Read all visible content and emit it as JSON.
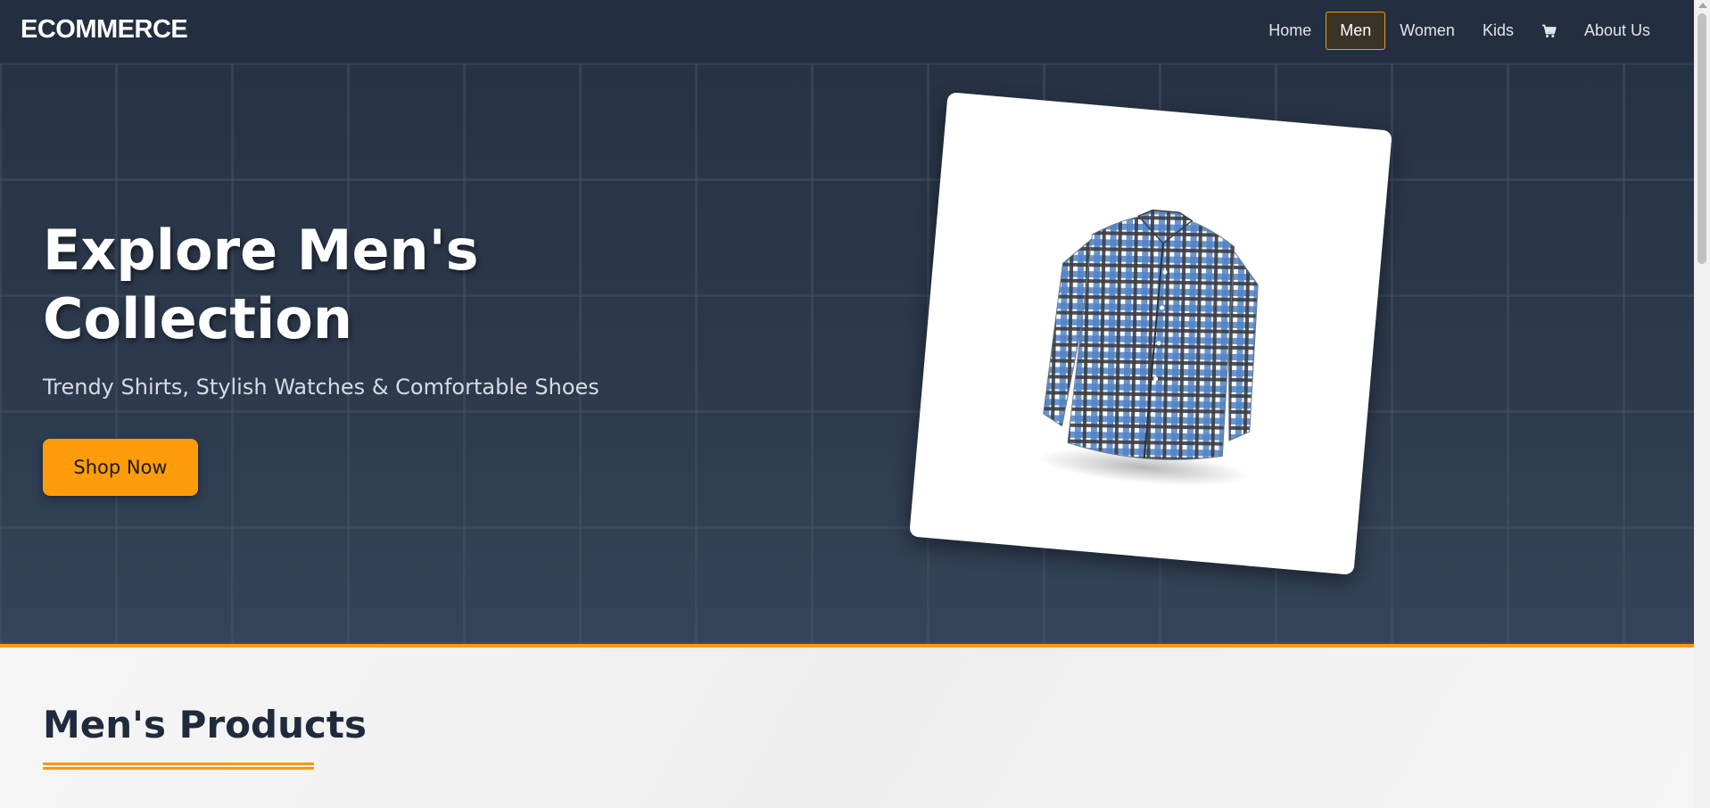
{
  "brand": "ECOMMERCE",
  "nav": {
    "items": [
      {
        "label": "Home"
      },
      {
        "label": "Men"
      },
      {
        "label": "Women"
      },
      {
        "label": "Kids"
      },
      {
        "label": "About Us"
      }
    ],
    "active": "Men",
    "cart_icon": "cart-icon"
  },
  "hero": {
    "title": "Explore Men's Collection",
    "subtitle": "Trendy Shirts, Stylish Watches & Comfortable Shoes",
    "cta": "Shop Now",
    "image": "plaid-shirt"
  },
  "products": {
    "title": "Men's Products"
  },
  "colors": {
    "navbar": "#232e40",
    "hero": "#2c394c",
    "accent": "#ff9800",
    "button": "#ff9c0a"
  }
}
